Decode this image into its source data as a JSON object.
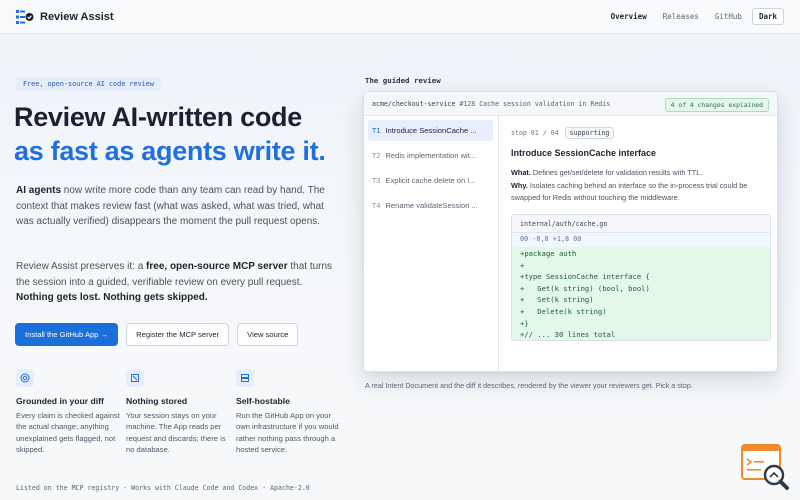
{
  "header": {
    "brand": "Review Assist",
    "nav": [
      "Overview",
      "Releases",
      "GitHub"
    ],
    "dark_label": "Dark"
  },
  "hero": {
    "badge": "Free, open-source AI code review",
    "title_line1": "Review AI-written code",
    "title_line2": "as fast as agents write it.",
    "p1_bold": "AI agents",
    "p1_rest": " now write more code than any team can read by hand. The context that makes review fast (what was asked, what was tried, what was actually verified) disappears the moment the pull request opens.",
    "p2_a": "Review Assist preserves it: a ",
    "p2_bold": "free, open-source MCP server",
    "p2_b": " that turns the session into a guided, verifiable review on every pull request. ",
    "p2_bold2": "Nothing gets lost. Nothing gets skipped.",
    "buttons": [
      "Install the GitHub App →",
      "Register the MCP server",
      "View source"
    ]
  },
  "features": [
    {
      "icon": "target-icon",
      "title": "Grounded in your diff",
      "desc": "Every claim is checked against the actual change; anything unexplained gets flagged, not skipped."
    },
    {
      "icon": "shield-icon",
      "title": "Nothing stored",
      "desc": "Your session stays on your machine. The App reads per request and discards; there is no database."
    },
    {
      "icon": "server-icon",
      "title": "Self-hostable",
      "desc": "Run the GitHub App on your own infrastructure if you would rather nothing pass through a hosted service."
    }
  ],
  "footer_line": "Listed on the MCP registry · Works with Claude Code and Codex · Apache-2.0",
  "review": {
    "section_label": "The guided review",
    "repo": "acme/checkout-service",
    "pr": "#128 Cache session validation in Redis",
    "explained": "4 of 4 changes explained",
    "tasks": [
      {
        "num": "T1",
        "label": "Introduce SessionCache ..."
      },
      {
        "num": "T2",
        "label": "Redis implementation wit..."
      },
      {
        "num": "T3",
        "label": "Explicit cache delete on l..."
      },
      {
        "num": "T4",
        "label": "Rename validateSession ..."
      }
    ],
    "stop": "stop 01 / 04",
    "stop_tag": "supporting",
    "stop_title": "Introduce SessionCache interface",
    "what_label": "What.",
    "what_text": " Defines get/set/delete for validation results with TTL.",
    "why_label": "Why.",
    "why_text": " Isolates caching behind an interface so the in-process trial could be swapped for Redis without touching the middleware.",
    "file": "internal/auth/cache.go",
    "hunk": "00 -0,0 +1,8 00",
    "lines": [
      "+package auth",
      "+",
      "+type SessionCache interface {",
      "+   Get(k string) (bool, bool)",
      "+   Set(k string)",
      "+   Delete(k string)",
      "+}",
      "+// ... 30 lines total"
    ],
    "caption": "A real Intent Document and the diff it describes, rendered by the viewer your reviewers get. Pick a stop."
  }
}
